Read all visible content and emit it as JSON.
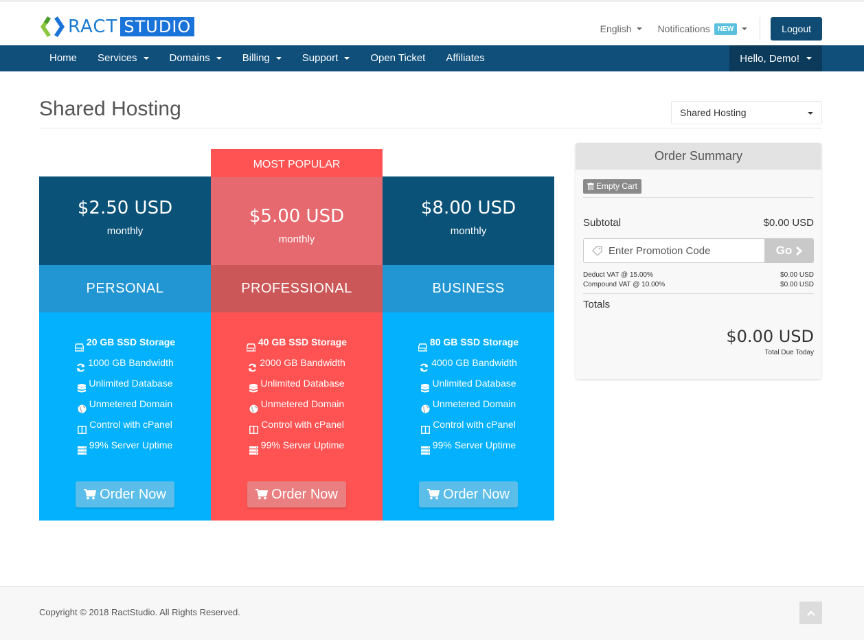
{
  "brand": {
    "name_part1": "RACT",
    "name_part2": "STUDIO",
    "colors": {
      "blue": "#1a73d9",
      "green": "#8cc63f",
      "navy": "#0f4f7a"
    }
  },
  "header": {
    "language": "English",
    "notifications": "Notifications",
    "notifications_badge": "NEW",
    "logout": "Logout"
  },
  "nav": {
    "items": [
      {
        "label": "Home",
        "dropdown": false
      },
      {
        "label": "Services",
        "dropdown": true
      },
      {
        "label": "Domains",
        "dropdown": true
      },
      {
        "label": "Billing",
        "dropdown": true
      },
      {
        "label": "Support",
        "dropdown": true
      },
      {
        "label": "Open Ticket",
        "dropdown": false
      },
      {
        "label": "Affiliates",
        "dropdown": false
      }
    ],
    "user": "Hello, Demo!"
  },
  "page": {
    "title": "Shared Hosting",
    "category_select": "Shared Hosting"
  },
  "plans": [
    {
      "price": "$2.50 USD",
      "cycle": "monthly",
      "name": "PERSONAL",
      "colors": {
        "price_bg": "#0b5279",
        "name_bg": "#2196d3",
        "features_bg": "#03b1fc",
        "button_bg": "#5bbde9"
      },
      "features": [
        {
          "icon": "hdd-icon",
          "text": "20 GB SSD Storage"
        },
        {
          "icon": "refresh-icon",
          "text": "1000 GB Bandwidth"
        },
        {
          "icon": "database-icon",
          "text": "Unlimited Database"
        },
        {
          "icon": "globe-icon",
          "text": "Unmetered Domain"
        },
        {
          "icon": "columns-icon",
          "text": "Control with cPanel"
        },
        {
          "icon": "server-icon",
          "text": "99% Server Uptime"
        }
      ],
      "order_label": "Order Now"
    },
    {
      "price": "$5.00 USD",
      "cycle": "monthly",
      "name": "PROFESSIONAL",
      "colors": {
        "price_bg": "#e5696e",
        "name_bg": "#cc5758",
        "features_bg": "#ff5252",
        "button_bg": "#e97f80"
      },
      "features": [
        {
          "icon": "hdd-icon",
          "text": "40 GB SSD Storage"
        },
        {
          "icon": "refresh-icon",
          "text": "2000 GB Bandwidth"
        },
        {
          "icon": "database-icon",
          "text": "Unlimited Database"
        },
        {
          "icon": "globe-icon",
          "text": "Unmetered Domain"
        },
        {
          "icon": "columns-icon",
          "text": "Control with cPanel"
        },
        {
          "icon": "server-icon",
          "text": "99% Server Uptime"
        }
      ],
      "order_label": "Order Now"
    },
    {
      "price": "$8.00 USD",
      "cycle": "monthly",
      "name": "BUSINESS",
      "colors": {
        "price_bg": "#0b5279",
        "name_bg": "#2196d3",
        "features_bg": "#03b1fc",
        "button_bg": "#5bbde9"
      },
      "features": [
        {
          "icon": "hdd-icon",
          "text": "80 GB SSD Storage"
        },
        {
          "icon": "refresh-icon",
          "text": "4000 GB Bandwidth"
        },
        {
          "icon": "database-icon",
          "text": "Unlimited Database"
        },
        {
          "icon": "globe-icon",
          "text": "Unmetered Domain"
        },
        {
          "icon": "columns-icon",
          "text": "Control with cPanel"
        },
        {
          "icon": "server-icon",
          "text": "99% Server Uptime"
        }
      ],
      "order_label": "Order Now"
    }
  ],
  "most_popular": "MOST POPULAR",
  "summary": {
    "title": "Order Summary",
    "empty_cart": "Empty Cart",
    "subtotal_label": "Subtotal",
    "subtotal_value": "$0.00 USD",
    "promo_placeholder": "Enter Promotion Code",
    "promo_go": "Go",
    "taxes": [
      {
        "label": "Deduct VAT @ 15.00%",
        "value": "$0.00 USD"
      },
      {
        "label": "Compound VAT @ 10.00%",
        "value": "$0.00 USD"
      }
    ],
    "totals_label": "Totals",
    "total_amount": "$0.00 USD",
    "total_due_label": "Total Due Today"
  },
  "footer": {
    "copyright": "Copyright © 2018 RactStudio. All Rights Reserved."
  }
}
